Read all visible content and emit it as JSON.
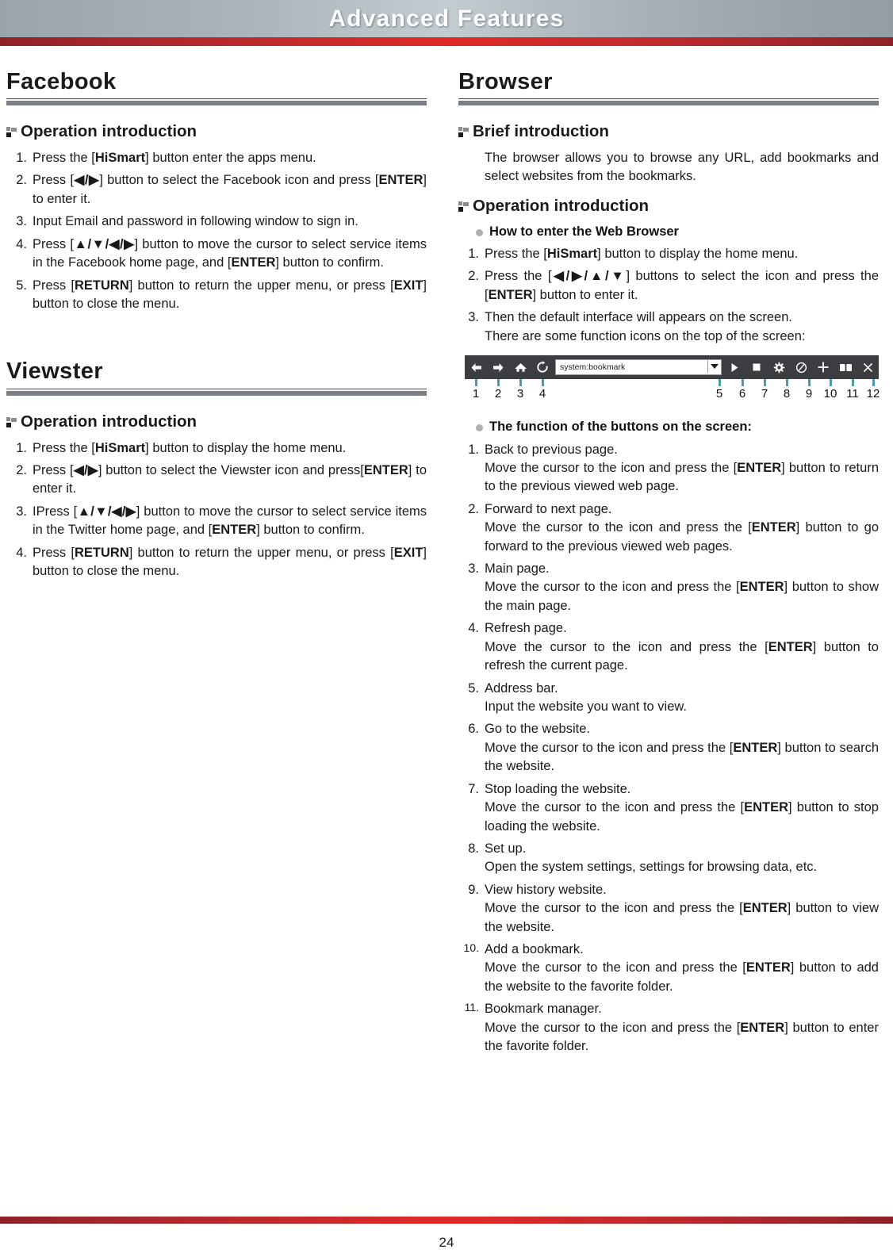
{
  "header": {
    "title": "Advanced Features"
  },
  "left_column": {
    "sections": [
      {
        "title": "Facebook",
        "subhead": "Operation introduction",
        "items": [
          {
            "num": "1.",
            "html": "Press the [<b>HiSmart</b>] button enter the apps menu."
          },
          {
            "num": "2.",
            "html": "Press [<b>◀/▶</b>] button to select the Facebook icon and press [<b>ENTER</b>] to enter it."
          },
          {
            "num": "3.",
            "html": "Input Email and password in following window to sign in."
          },
          {
            "num": "4.",
            "html": "Press [<b>▲/▼/◀/▶</b>] button to move the cursor to select service items in the Facebook home page, and [<b>ENTER</b>] button to confirm."
          },
          {
            "num": "5.",
            "html": "Press [<b>RETURN</b>] button to return the upper menu, or press [<b>EXIT</b>] button to close the menu."
          }
        ]
      },
      {
        "title": "Viewster",
        "subhead": "Operation introduction",
        "items": [
          {
            "num": "1.",
            "html": "Press the [<b>HiSmart</b>] button to display the home menu."
          },
          {
            "num": "2.",
            "html": "Press [<b>◀/▶</b>] button to select the Viewster icon and press[<b>ENTER</b>] to enter it."
          },
          {
            "num": "3.",
            "html": "IPress [<b>▲/▼/◀/▶</b>] button to move the cursor to select service items in the Twitter home page, and [<b>ENTER</b>] button to confirm."
          },
          {
            "num": "4.",
            "html": "Press [<b>RETURN</b>] button to return the upper menu, or press [<b>EXIT</b>] button to close the menu."
          }
        ]
      }
    ]
  },
  "right_column": {
    "title": "Browser",
    "brief": {
      "subhead": "Brief introduction",
      "paragraph": "The browser allows you to browse any URL, add bookmarks and select websites from the bookmarks."
    },
    "operation": {
      "subhead": "Operation introduction",
      "how_to_enter_heading": "How to enter the Web Browser",
      "how_to_enter_items": [
        {
          "num": "1.",
          "html": "Press the [<b>HiSmart</b>] button to display the home menu."
        },
        {
          "num": "2.",
          "html": "Press the [<b>◀/▶/▲/▼</b>] buttons to select the icon and press the [<b>ENTER</b>] button to enter it."
        },
        {
          "num": "3.",
          "html": "Then the default interface will appears on the screen.<span class=\"sub\">There are some function icons on the top of the screen:</span>"
        }
      ],
      "function_heading": "The function of the buttons on the screen:",
      "function_items": [
        {
          "num": "1.",
          "html": "Back to previous page.<span class=\"sub\">Move the cursor to the icon and press the [<b>ENTER</b>] button to return to the previous viewed web page.</span>"
        },
        {
          "num": "2.",
          "html": "Forward to next page.<span class=\"sub\">Move the cursor to the icon and press the [<b>ENTER</b>] button to go forward to the previous viewed web pages.</span>"
        },
        {
          "num": "3.",
          "html": "Main page.<span class=\"sub\">Move the cursor to the icon and press the [<b>ENTER</b>] button to show the main page.</span>"
        },
        {
          "num": "4.",
          "html": "Refresh page.<span class=\"sub\">Move the cursor to the icon and press the [<b>ENTER</b>] button to refresh the current page.</span>"
        },
        {
          "num": "5.",
          "html": "Address bar.<span class=\"sub\">Input the website you want to view.</span>"
        },
        {
          "num": "6.",
          "html": "Go to the website.<span class=\"sub\">Move the cursor to the icon and press the [<b>ENTER</b>] button to search the website.</span>"
        },
        {
          "num": "7.",
          "html": "Stop loading the website.<span class=\"sub\">Move the cursor to the icon and press the [<b>ENTER</b>] button to stop loading the website.</span>"
        },
        {
          "num": "8.",
          "html": "Set up.<span class=\"sub\">Open the system settings, settings for browsing data, etc.</span>"
        },
        {
          "num": "9.",
          "html": "View history website.<span class=\"sub\">Move the cursor to the icon and press the [<b>ENTER</b>] button to view the website.</span>"
        },
        {
          "num": "10.",
          "html": "Add a bookmark.<span class=\"sub\">Move the cursor to the icon and press the [<b>ENTER</b>] button to add the website to the favorite folder.</span>"
        },
        {
          "num": "11.",
          "html": "Bookmark manager.<span class=\"sub\">Move the cursor to the icon and press the [<b>ENTER</b>] button to enter the favorite folder.</span>"
        }
      ]
    }
  },
  "browser_toolbar_figure": {
    "address_value": "system:bookmark",
    "background_color": "#3b3d40",
    "callout_color": "#4a9aa8",
    "icons": [
      {
        "callout": "1",
        "name": "back-arrow-icon"
      },
      {
        "callout": "2",
        "name": "forward-arrow-icon"
      },
      {
        "callout": "3",
        "name": "home-icon"
      },
      {
        "callout": "4",
        "name": "refresh-icon"
      },
      {
        "callout": "5",
        "name": "address-bar-dropdown-icon"
      },
      {
        "callout": "6",
        "name": "go-play-icon"
      },
      {
        "callout": "7",
        "name": "stop-square-icon"
      },
      {
        "callout": "8",
        "name": "settings-gear-icon"
      },
      {
        "callout": "9",
        "name": "history-clock-icon"
      },
      {
        "callout": "10",
        "name": "add-plus-icon"
      },
      {
        "callout": "11",
        "name": "bookmark-book-icon"
      },
      {
        "callout": "12",
        "name": "close-x-icon"
      }
    ]
  },
  "footer": {
    "page_number": "24"
  }
}
